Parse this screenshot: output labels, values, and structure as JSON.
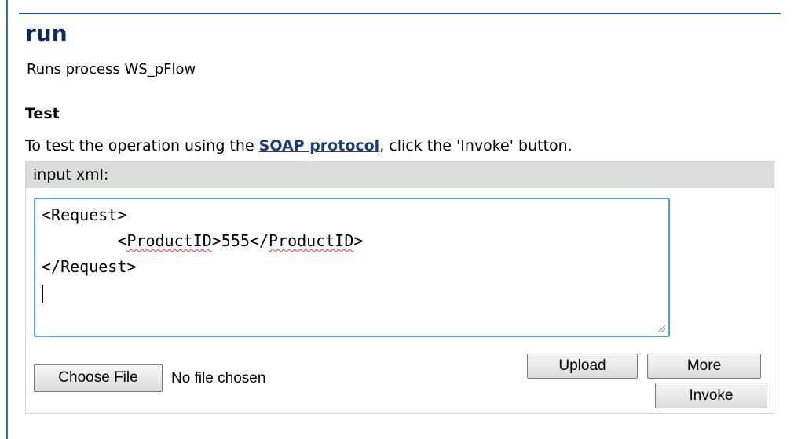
{
  "operation": {
    "title": "run",
    "description": "Runs process WS_pFlow"
  },
  "test": {
    "heading": "Test",
    "instruction_prefix": "To test the operation using the ",
    "link_text": "SOAP protocol",
    "instruction_suffix": ", click the 'Invoke' button."
  },
  "input": {
    "header": "input xml:",
    "xml_line1": "<Request>",
    "xml_indent": "        ",
    "xml_tag_open_prefix": "<",
    "xml_tag_name": "ProductID",
    "xml_tag_open_suffix": ">555</",
    "xml_tag_close_suffix": ">",
    "xml_line3": "</Request>"
  },
  "buttons": {
    "choose_file": "Choose File",
    "no_file": "No file chosen",
    "upload": "Upload",
    "more": "More",
    "invoke": "Invoke"
  },
  "colors": {
    "title": "#0b2a5b",
    "link": "#1c3d7c",
    "border_accent": "#5b9bd5",
    "header_bg": "#dcdcdc"
  },
  "icons": {
    "resize": "resize-grip-icon"
  }
}
